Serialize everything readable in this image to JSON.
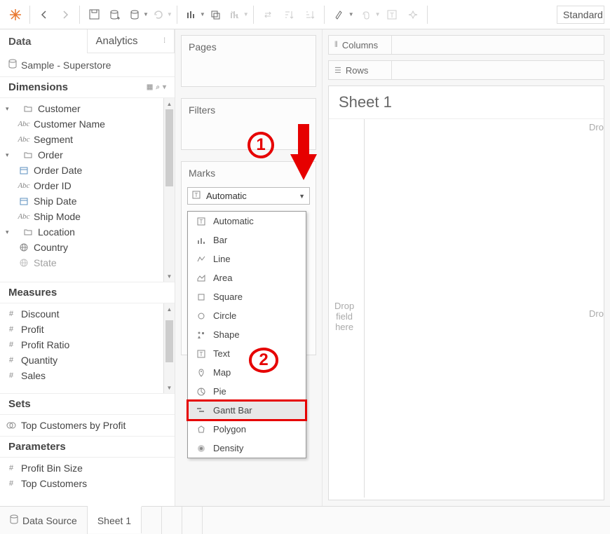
{
  "toolbar": {
    "style_select": "Standard"
  },
  "side": {
    "tabs": {
      "data": "Data",
      "analytics": "Analytics"
    },
    "datasource": "Sample - Superstore",
    "sections": {
      "dimensions": "Dimensions",
      "measures": "Measures",
      "sets": "Sets",
      "parameters": "Parameters"
    },
    "dim_tree": [
      {
        "label": "Customer",
        "type": "folder",
        "expanded": true,
        "level": 0
      },
      {
        "label": "Customer Name",
        "type": "abc",
        "level": 1
      },
      {
        "label": "Segment",
        "type": "abc",
        "level": 1
      },
      {
        "label": "Order",
        "type": "folder",
        "expanded": true,
        "level": 0
      },
      {
        "label": "Order Date",
        "type": "date",
        "level": 1
      },
      {
        "label": "Order ID",
        "type": "abc",
        "level": 1
      },
      {
        "label": "Ship Date",
        "type": "date",
        "level": 1
      },
      {
        "label": "Ship Mode",
        "type": "abc",
        "level": 1
      },
      {
        "label": "Location",
        "type": "folder",
        "expanded": true,
        "level": 0
      },
      {
        "label": "Country",
        "type": "globe",
        "level": 1
      },
      {
        "label": "State",
        "type": "globe",
        "level": 1,
        "dim": true
      }
    ],
    "meas_tree": [
      {
        "label": "Discount",
        "type": "hash"
      },
      {
        "label": "Profit",
        "type": "hash"
      },
      {
        "label": "Profit Ratio",
        "type": "hash"
      },
      {
        "label": "Quantity",
        "type": "hash"
      },
      {
        "label": "Sales",
        "type": "hash"
      }
    ],
    "sets_tree": [
      {
        "label": "Top Customers by Profit",
        "type": "set"
      }
    ],
    "params_tree": [
      {
        "label": "Profit Bin Size",
        "type": "hash"
      },
      {
        "label": "Top Customers",
        "type": "hash"
      }
    ]
  },
  "shelves": {
    "pages": "Pages",
    "filters": "Filters",
    "marks": "Marks",
    "marks_selected": "Automatic",
    "marks_options": [
      {
        "label": "Automatic",
        "icon": "auto"
      },
      {
        "label": "Bar",
        "icon": "bar"
      },
      {
        "label": "Line",
        "icon": "line"
      },
      {
        "label": "Area",
        "icon": "area"
      },
      {
        "label": "Square",
        "icon": "square"
      },
      {
        "label": "Circle",
        "icon": "circle"
      },
      {
        "label": "Shape",
        "icon": "shape"
      },
      {
        "label": "Text",
        "icon": "text"
      },
      {
        "label": "Map",
        "icon": "map"
      },
      {
        "label": "Pie",
        "icon": "pie"
      },
      {
        "label": "Gantt Bar",
        "icon": "gantt",
        "highlighted": true
      },
      {
        "label": "Polygon",
        "icon": "polygon"
      },
      {
        "label": "Density",
        "icon": "density"
      }
    ],
    "columns": "Columns",
    "rows": "Rows"
  },
  "canvas": {
    "sheet_title": "Sheet 1",
    "drop_here": "Drop\nfield\nhere",
    "drop_right": "Dro"
  },
  "bottom": {
    "data_source": "Data Source",
    "sheet1": "Sheet 1"
  },
  "annotations": {
    "step1": "1",
    "step2": "2"
  }
}
